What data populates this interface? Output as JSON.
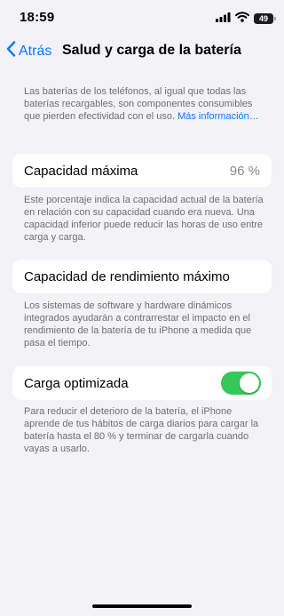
{
  "status_bar": {
    "time": "18:59",
    "battery_level": "49"
  },
  "nav": {
    "back_label": "Atrás",
    "title": "Salud y carga de la batería"
  },
  "intro": {
    "text": "Las baterías de los teléfonos, al igual que todas las baterías recargables, son componentes consumibles que pierden efectividad con el uso.",
    "link_label": "Más información…"
  },
  "max_capacity": {
    "label": "Capacidad máxima",
    "value": "96 %",
    "footnote": "Este porcentaje indica la capacidad actual de la batería en relación con su capacidad cuando era nueva. Una capacidad inferior puede reducir las horas de uso entre carga y carga."
  },
  "peak_performance": {
    "label": "Capacidad de rendimiento máximo",
    "footnote": "Los sistemas de software y hardware dinámicos integrados ayudarán a contrarrestar el impacto en el rendimiento de la batería de tu iPhone a medida que pasa el tiempo."
  },
  "optimized_charging": {
    "label": "Carga optimizada",
    "enabled": true,
    "footnote": "Para reducir el deterioro de la batería, el iPhone aprende de tus hábitos de carga diarios para cargar la batería hasta el 80 % y terminar de cargarla cuando vayas a usarlo."
  },
  "colors": {
    "accent": "#0a7aff",
    "toggle_on": "#34c759",
    "background": "#f2f2f7"
  }
}
